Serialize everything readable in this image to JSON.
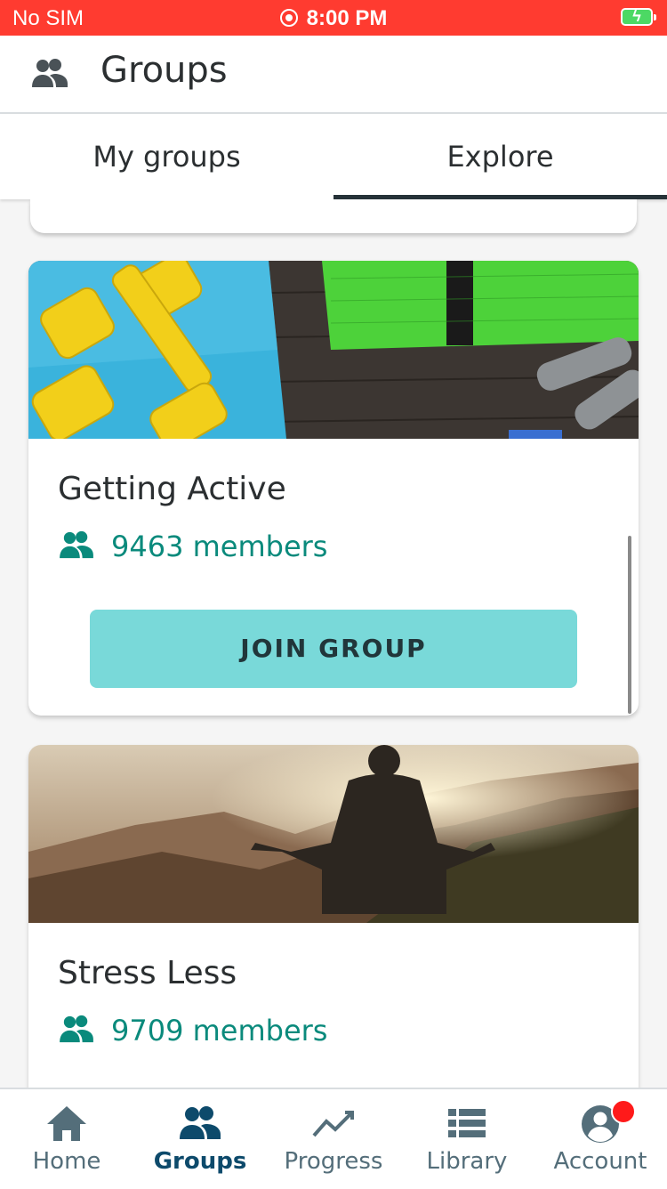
{
  "status_bar": {
    "carrier": "No SIM",
    "time": "8:00 PM"
  },
  "header": {
    "title": "Groups",
    "icon": "people-icon"
  },
  "tabs": [
    {
      "label": "My groups",
      "active": false
    },
    {
      "label": "Explore",
      "active": true
    }
  ],
  "groups": [
    {
      "name": "Getting Active",
      "members": "9463 members",
      "join_label": "JOIN GROUP",
      "image": "fitness-equipment-photo"
    },
    {
      "name": "Stress Less",
      "members": "9709 members",
      "image": "meditation-mountain-photo"
    }
  ],
  "bottom_nav": [
    {
      "label": "Home",
      "icon": "home-icon",
      "active": false
    },
    {
      "label": "Groups",
      "icon": "people-icon",
      "active": true
    },
    {
      "label": "Progress",
      "icon": "trend-line-icon",
      "active": false
    },
    {
      "label": "Library",
      "icon": "list-icon",
      "active": false
    },
    {
      "label": "Account",
      "icon": "account-circle-icon",
      "active": false,
      "badge": true
    }
  ],
  "colors": {
    "status_bar": "#ff3b30",
    "member_text": "#0a8a7c",
    "join_button": "#79d9d9",
    "nav_active": "#0d4a6b",
    "nav_inactive": "#546e7a",
    "badge": "#ff1a1a"
  }
}
